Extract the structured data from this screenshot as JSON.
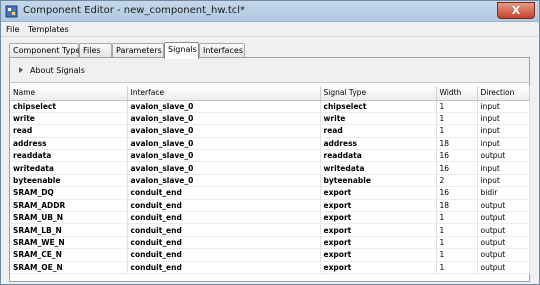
{
  "window": {
    "title": "Component Editor - new_component_hw.tcl*",
    "close_label": "X"
  },
  "menubar": {
    "items": [
      "File",
      "Templates"
    ]
  },
  "tabs": [
    "Component Type",
    "Files",
    "Parameters",
    "Signals",
    "Interfaces"
  ],
  "active_tab": "Signals",
  "section": {
    "label": "About Signals"
  },
  "table": {
    "columns": [
      "Name",
      "Interface",
      "Signal Type",
      "Width",
      "Direction"
    ],
    "rows": [
      [
        "chipselect",
        "avalon_slave_0",
        "chipselect",
        "1",
        "input"
      ],
      [
        "write",
        "avalon_slave_0",
        "write",
        "1",
        "input"
      ],
      [
        "read",
        "avalon_slave_0",
        "read",
        "1",
        "input"
      ],
      [
        "address",
        "avalon_slave_0",
        "address",
        "18",
        "input"
      ],
      [
        "readdata",
        "avalon_slave_0",
        "readdata",
        "16",
        "output"
      ],
      [
        "writedata",
        "avalon_slave_0",
        "writedata",
        "16",
        "input"
      ],
      [
        "byteenable",
        "avalon_slave_0",
        "byteenable",
        "2",
        "input"
      ],
      [
        "SRAM_DQ",
        "conduit_end",
        "export",
        "16",
        "bidir"
      ],
      [
        "SRAM_ADDR",
        "conduit_end",
        "export",
        "18",
        "output"
      ],
      [
        "SRAM_UB_N",
        "conduit_end",
        "export",
        "1",
        "output"
      ],
      [
        "SRAM_LB_N",
        "conduit_end",
        "export",
        "1",
        "output"
      ],
      [
        "SRAM_WE_N",
        "conduit_end",
        "export",
        "1",
        "output"
      ],
      [
        "SRAM_CE_N",
        "conduit_end",
        "export",
        "1",
        "output"
      ],
      [
        "SRAM_OE_N",
        "conduit_end",
        "export",
        "1",
        "output"
      ]
    ]
  },
  "colors": {
    "titlebar": "#b7cde4",
    "close_button": "#c7432a",
    "panel": "#f0f0f0"
  },
  "icons": {
    "app": "component-editor-icon",
    "caret": "caret-right-icon"
  }
}
